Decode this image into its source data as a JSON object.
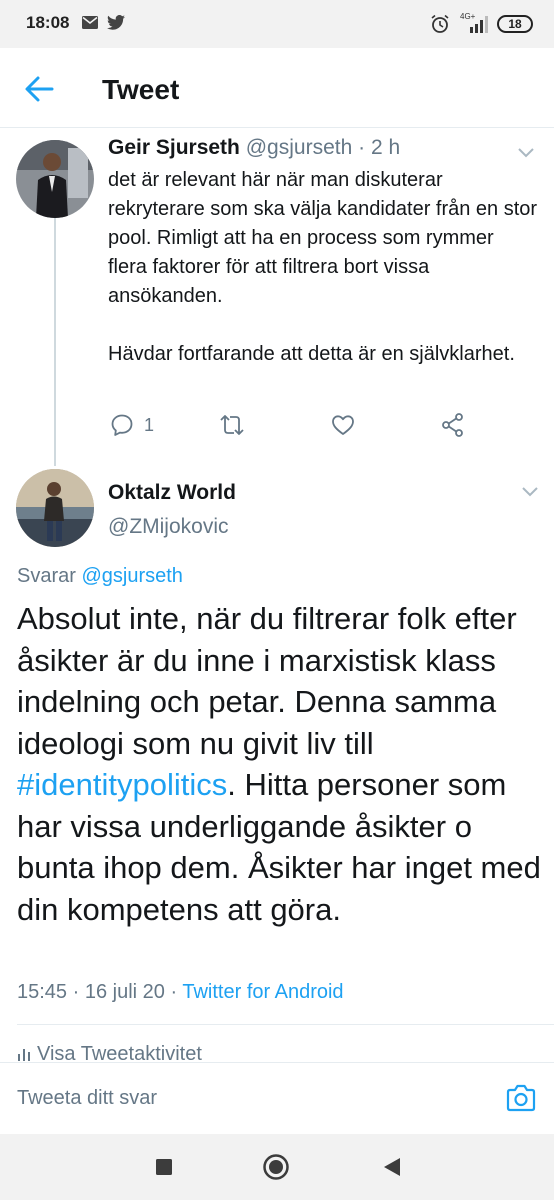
{
  "status_bar": {
    "time": "18:08",
    "network": "4G+",
    "battery": "18",
    "icons": [
      "mail-icon",
      "twitter-icon",
      "alarm-icon",
      "signal-icon",
      "battery-icon"
    ]
  },
  "header": {
    "title": "Tweet",
    "back_icon": "back-arrow-icon"
  },
  "parent_tweet": {
    "name": "Geir Sjurseth",
    "handle": "@gsjurseth",
    "separator": "·",
    "time": "2 h",
    "body": "det är relevant här när man diskuterar rekryterare som ska välja kandidater från en stor pool. Rimligt att ha en process som rymmer flera faktorer för att filtrera bort vissa ansökanden.\n\nHävdar fortfarande att detta är en självklarhet.",
    "reply_count": "1",
    "actions": [
      "reply-icon",
      "retweet-icon",
      "like-icon",
      "share-icon"
    ]
  },
  "main_tweet": {
    "name": "Oktalz World",
    "handle": "@ZMijokovic",
    "reply_prefix": "Svarar",
    "reply_to": "@gsjurseth",
    "body_before": "Absolut inte, när du filtrerar folk efter åsikter är du inne i marxistisk klass indelning och petar. Denna samma ideologi som nu givit liv till ",
    "hashtag": "#identitypolitics",
    "body_after": ". Hitta personer som har vissa underliggande åsikter o bunta ihop dem. Åsikter har inget med din kompetens att göra.",
    "time": "15:45",
    "date_sep": "·",
    "date": "16 juli 20",
    "source_sep": "·",
    "source": "Twitter for Android",
    "activity": "Visa Tweetaktivitet"
  },
  "composer": {
    "placeholder": "Tweeta ditt svar",
    "camera_icon": "camera-icon"
  },
  "nav_bar": [
    "recents-square-icon",
    "home-circle-icon",
    "back-triangle-icon"
  ],
  "colors": {
    "accent": "#1da1f2",
    "text": "#14171a",
    "muted": "#657786",
    "divider": "#e6ecf0"
  }
}
